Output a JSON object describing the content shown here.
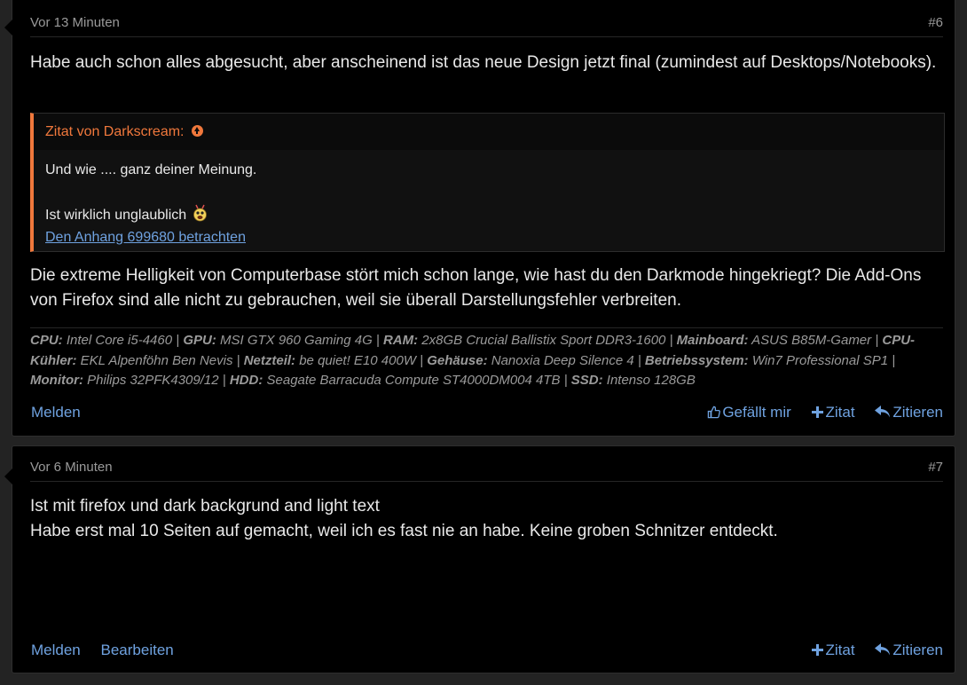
{
  "posts": [
    {
      "time": "Vor 13 Minuten",
      "number": "#6",
      "text1": "Habe auch schon alles abgesucht, aber anscheinend ist das neue Design jetzt final (zumindest auf Desktops/Notebooks).",
      "quote": {
        "header": "Zitat von Darkscream:",
        "line1": "Und wie .... ganz deiner Meinung.",
        "line2": "Ist wirklich unglaublich",
        "attachment": "Den Anhang 699680 betrachten"
      },
      "text2": "Die extreme Helligkeit von Computerbase stört mich schon lange, wie hast du den Darkmode hingekriegt? Die Add-Ons von Firefox sind alle nicht zu gebrauchen, weil sie überall Darstellungsfehler verbreiten.",
      "signature": [
        {
          "label": "CPU:",
          "value": "Intel Core i5-4460"
        },
        {
          "label": "GPU:",
          "value": "MSI GTX 960 Gaming 4G"
        },
        {
          "label": "RAM:",
          "value": "2x8GB Crucial Ballistix Sport DDR3-1600"
        },
        {
          "label": "Mainboard:",
          "value": "ASUS B85M-Gamer"
        },
        {
          "label": "CPU-Kühler:",
          "value": "EKL Alpenföhn Ben Nevis"
        },
        {
          "label": "Netzteil:",
          "value": "be quiet! E10 400W"
        },
        {
          "label": "Gehäuse:",
          "value": "Nanoxia Deep Silence 4"
        },
        {
          "label": "Betriebssystem:",
          "value": "Win7 Professional SP1"
        },
        {
          "label": "Monitor:",
          "value": "Philips 32PFK4309/12"
        },
        {
          "label": "HDD:",
          "value": "Seagate Barracuda Compute ST4000DM004 4TB"
        },
        {
          "label": "SSD:",
          "value": "Intenso 128GB"
        }
      ],
      "footer": {
        "report": "Melden",
        "like": "Gefällt mir",
        "quote": "Zitat",
        "reply": "Zitieren"
      }
    },
    {
      "time": "Vor 6 Minuten",
      "number": "#7",
      "line1": "Ist mit firefox und dark backgrund and light text",
      "line2": "Habe erst mal 10 Seiten auf gemacht, weil ich es fast nie an habe. Keine groben Schnitzer entdeckt.",
      "footer": {
        "report": "Melden",
        "edit": "Bearbeiten",
        "quote": "Zitat",
        "reply": "Zitieren"
      }
    }
  ],
  "colors": {
    "background": "#000000",
    "text": "#e9e9e9",
    "muted": "#9a9a9a",
    "link": "#6fa2e0",
    "quote_accent": "#f0783c"
  },
  "icons": {
    "quote_source": "arrow-circle-up-icon",
    "like": "thumbs-up-icon",
    "quote": "plus-icon",
    "reply": "reply-icon",
    "smiley": "smiley-icon"
  }
}
